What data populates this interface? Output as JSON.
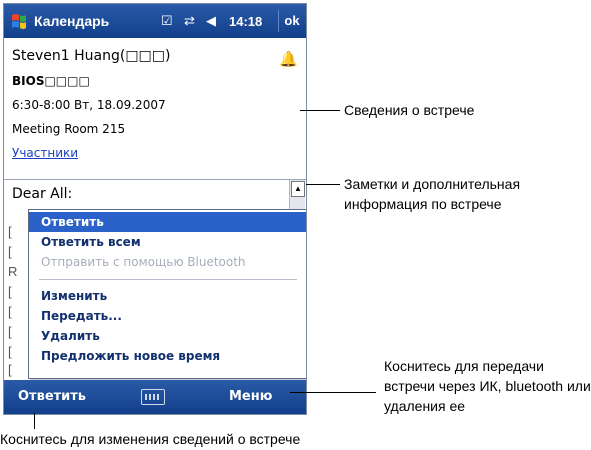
{
  "titlebar": {
    "app_title": "Календарь",
    "time": "14:18",
    "ok": "ok",
    "icons": [
      "start-flag",
      "check-icon",
      "connectivity-icon",
      "volume-icon"
    ]
  },
  "appointment": {
    "subject": "Steven1 Huang(□□□)",
    "line2": "BIOS□□□□",
    "datetime": "6:30-8:00 Вт, 18.09.2007",
    "location": "Meeting Room 215",
    "attendees_link": "Участники"
  },
  "notes": {
    "text": "Dear All:",
    "edge_chars": [
      "[",
      "[",
      "R",
      "[",
      "[",
      "[",
      "[",
      "["
    ]
  },
  "menu": {
    "items": [
      {
        "label": "Ответить",
        "state": "selected"
      },
      {
        "label": "Ответить всем",
        "state": "normal"
      },
      {
        "label": "Отправить с помощью Bluetooth",
        "state": "disabled"
      },
      {
        "label": "Изменить",
        "state": "normal"
      },
      {
        "label": "Передать...",
        "state": "normal"
      },
      {
        "label": "Удалить",
        "state": "normal"
      },
      {
        "label": "Предложить новое время",
        "state": "normal"
      }
    ]
  },
  "bottombar": {
    "left": "Ответить",
    "right": "Меню"
  },
  "callouts": {
    "info": "Сведения о встрече",
    "notes_line1": "Заметки и дополнительная",
    "notes_line2": "информация по встрече",
    "menu_line1": "Коснитесь для передачи",
    "menu_line2": "встречи через ИК, bluetooth или",
    "menu_line3": "удаления ее",
    "edit": "Коснитесь для изменения сведений о встрече"
  }
}
